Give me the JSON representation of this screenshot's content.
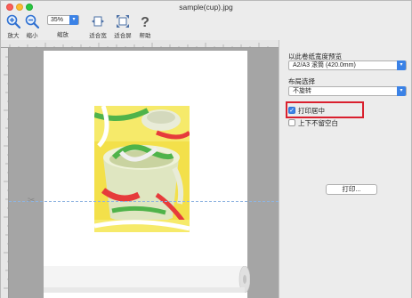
{
  "window": {
    "title": "sample(cup).jpg"
  },
  "toolbar": {
    "zoom_in_label": "放大",
    "zoom_out_label": "缩小",
    "zoom_value": "35%",
    "zoom_label": "缩放",
    "fit_width_label": "适合宽度",
    "fit_screen_label": "适合屏幕",
    "help_label": "帮助"
  },
  "panel": {
    "roll_width_label": "以此卷纸宽度预览",
    "roll_width_value": "A2/A3 滚筒 (420.0mm)",
    "layout_label": "布局选择",
    "layout_value": "不旋转",
    "print_center_label": "打印居中",
    "no_margin_label": "上下不留空白",
    "print_button_label": "打印..."
  },
  "accent_color": "#3b82e6",
  "highlight_color": "#d9202e"
}
